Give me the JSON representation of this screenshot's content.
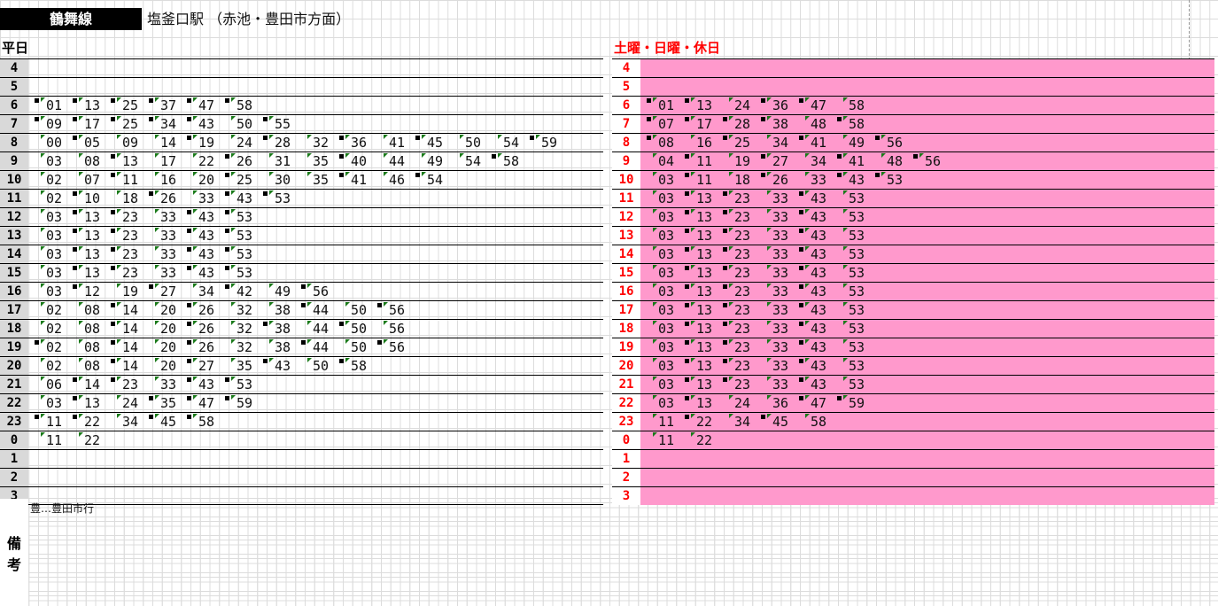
{
  "header": {
    "line_name": "鶴舞線",
    "station": "塩釜口駅 （赤池・豊田市方面）"
  },
  "colors": {
    "weekend_fill": "#ff99cc",
    "weekend_text": "#ff0000",
    "marker": "#1a7a1a"
  },
  "weekday": {
    "title": "平日",
    "rows": [
      {
        "hour": "4",
        "times": []
      },
      {
        "hour": "5",
        "times": []
      },
      {
        "hour": "6",
        "times": [
          [
            "01",
            1
          ],
          [
            "13",
            1
          ],
          [
            "25",
            1
          ],
          [
            "37",
            1
          ],
          [
            "47",
            1
          ],
          [
            "58",
            1
          ]
        ]
      },
      {
        "hour": "7",
        "times": [
          [
            "09",
            1
          ],
          [
            "17",
            1
          ],
          [
            "25",
            1
          ],
          [
            "34",
            1
          ],
          [
            "43",
            1
          ],
          [
            "50",
            0
          ],
          [
            "55",
            1
          ]
        ]
      },
      {
        "hour": "8",
        "times": [
          [
            "00",
            0
          ],
          [
            "05",
            1
          ],
          [
            "09",
            0
          ],
          [
            "14",
            0
          ],
          [
            "19",
            1
          ],
          [
            "24",
            0
          ],
          [
            "28",
            1
          ],
          [
            "32",
            0
          ],
          [
            "36",
            1
          ],
          [
            "41",
            0
          ],
          [
            "45",
            1
          ],
          [
            "50",
            0
          ],
          [
            "54",
            0
          ],
          [
            "59",
            1
          ]
        ]
      },
      {
        "hour": "9",
        "times": [
          [
            "03",
            0
          ],
          [
            "08",
            0
          ],
          [
            "13",
            1
          ],
          [
            "17",
            0
          ],
          [
            "22",
            0
          ],
          [
            "26",
            1
          ],
          [
            "31",
            0
          ],
          [
            "35",
            0
          ],
          [
            "40",
            1
          ],
          [
            "44",
            0
          ],
          [
            "49",
            0
          ],
          [
            "54",
            0
          ],
          [
            "58",
            1
          ]
        ]
      },
      {
        "hour": "10",
        "times": [
          [
            "02",
            0
          ],
          [
            "07",
            0
          ],
          [
            "11",
            1
          ],
          [
            "16",
            0
          ],
          [
            "20",
            0
          ],
          [
            "25",
            1
          ],
          [
            "30",
            0
          ],
          [
            "35",
            0
          ],
          [
            "41",
            1
          ],
          [
            "46",
            0
          ],
          [
            "54",
            1
          ]
        ]
      },
      {
        "hour": "11",
        "times": [
          [
            "02",
            0
          ],
          [
            "10",
            1
          ],
          [
            "18",
            0
          ],
          [
            "26",
            1
          ],
          [
            "33",
            0
          ],
          [
            "43",
            1
          ],
          [
            "53",
            1
          ]
        ]
      },
      {
        "hour": "12",
        "times": [
          [
            "03",
            0
          ],
          [
            "13",
            1
          ],
          [
            "23",
            1
          ],
          [
            "33",
            0
          ],
          [
            "43",
            1
          ],
          [
            "53",
            1
          ]
        ]
      },
      {
        "hour": "13",
        "times": [
          [
            "03",
            0
          ],
          [
            "13",
            1
          ],
          [
            "23",
            1
          ],
          [
            "33",
            0
          ],
          [
            "43",
            1
          ],
          [
            "53",
            1
          ]
        ]
      },
      {
        "hour": "14",
        "times": [
          [
            "03",
            0
          ],
          [
            "13",
            1
          ],
          [
            "23",
            1
          ],
          [
            "33",
            0
          ],
          [
            "43",
            1
          ],
          [
            "53",
            1
          ]
        ]
      },
      {
        "hour": "15",
        "times": [
          [
            "03",
            0
          ],
          [
            "13",
            1
          ],
          [
            "23",
            1
          ],
          [
            "33",
            0
          ],
          [
            "43",
            1
          ],
          [
            "53",
            1
          ]
        ]
      },
      {
        "hour": "16",
        "times": [
          [
            "03",
            0
          ],
          [
            "12",
            1
          ],
          [
            "19",
            0
          ],
          [
            "27",
            1
          ],
          [
            "34",
            0
          ],
          [
            "42",
            1
          ],
          [
            "49",
            0
          ],
          [
            "56",
            1
          ]
        ]
      },
      {
        "hour": "17",
        "times": [
          [
            "02",
            0
          ],
          [
            "08",
            0
          ],
          [
            "14",
            1
          ],
          [
            "20",
            0
          ],
          [
            "26",
            1
          ],
          [
            "32",
            0
          ],
          [
            "38",
            0
          ],
          [
            "44",
            1
          ],
          [
            "50",
            0
          ],
          [
            "56",
            1
          ]
        ]
      },
      {
        "hour": "18",
        "times": [
          [
            "02",
            0
          ],
          [
            "08",
            0
          ],
          [
            "14",
            1
          ],
          [
            "20",
            0
          ],
          [
            "26",
            1
          ],
          [
            "32",
            0
          ],
          [
            "38",
            1
          ],
          [
            "44",
            0
          ],
          [
            "50",
            1
          ],
          [
            "56",
            0
          ]
        ]
      },
      {
        "hour": "19",
        "times": [
          [
            "02",
            1
          ],
          [
            "08",
            0
          ],
          [
            "14",
            1
          ],
          [
            "20",
            0
          ],
          [
            "26",
            1
          ],
          [
            "32",
            0
          ],
          [
            "38",
            0
          ],
          [
            "44",
            1
          ],
          [
            "50",
            0
          ],
          [
            "56",
            1
          ]
        ]
      },
      {
        "hour": "20",
        "times": [
          [
            "02",
            0
          ],
          [
            "08",
            0
          ],
          [
            "14",
            1
          ],
          [
            "20",
            0
          ],
          [
            "27",
            1
          ],
          [
            "35",
            0
          ],
          [
            "43",
            1
          ],
          [
            "50",
            0
          ],
          [
            "58",
            1
          ]
        ]
      },
      {
        "hour": "21",
        "times": [
          [
            "06",
            0
          ],
          [
            "14",
            1
          ],
          [
            "23",
            1
          ],
          [
            "33",
            0
          ],
          [
            "43",
            1
          ],
          [
            "53",
            1
          ]
        ]
      },
      {
        "hour": "22",
        "times": [
          [
            "03",
            0
          ],
          [
            "13",
            1
          ],
          [
            "24",
            0
          ],
          [
            "35",
            1
          ],
          [
            "47",
            1
          ],
          [
            "59",
            1
          ]
        ]
      },
      {
        "hour": "23",
        "times": [
          [
            "11",
            1
          ],
          [
            "22",
            1
          ],
          [
            "34",
            0
          ],
          [
            "45",
            1
          ],
          [
            "58",
            1
          ]
        ]
      },
      {
        "hour": "0",
        "times": [
          [
            "11",
            0
          ],
          [
            "22",
            0
          ]
        ]
      },
      {
        "hour": "1",
        "times": []
      },
      {
        "hour": "2",
        "times": []
      },
      {
        "hour": "3",
        "times": []
      }
    ]
  },
  "weekend": {
    "title": "土曜・日曜・休日",
    "rows": [
      {
        "hour": "4",
        "times": []
      },
      {
        "hour": "5",
        "times": []
      },
      {
        "hour": "6",
        "times": [
          [
            "01",
            1
          ],
          [
            "13",
            1
          ],
          [
            "24",
            0
          ],
          [
            "36",
            1
          ],
          [
            "47",
            1
          ],
          [
            "58",
            0
          ]
        ]
      },
      {
        "hour": "7",
        "times": [
          [
            "07",
            1
          ],
          [
            "17",
            1
          ],
          [
            "28",
            1
          ],
          [
            "38",
            1
          ],
          [
            "48",
            0
          ],
          [
            "58",
            1
          ]
        ]
      },
      {
        "hour": "8",
        "times": [
          [
            "08",
            1
          ],
          [
            "16",
            0
          ],
          [
            "25",
            1
          ],
          [
            "34",
            0
          ],
          [
            "41",
            1
          ],
          [
            "49",
            0
          ],
          [
            "56",
            1
          ]
        ]
      },
      {
        "hour": "9",
        "times": [
          [
            "04",
            0
          ],
          [
            "11",
            1
          ],
          [
            "19",
            0
          ],
          [
            "27",
            1
          ],
          [
            "34",
            0
          ],
          [
            "41",
            1
          ],
          [
            "48",
            0
          ],
          [
            "56",
            1
          ]
        ]
      },
      {
        "hour": "10",
        "times": [
          [
            "03",
            0
          ],
          [
            "11",
            1
          ],
          [
            "18",
            0
          ],
          [
            "26",
            1
          ],
          [
            "33",
            0
          ],
          [
            "43",
            1
          ],
          [
            "53",
            1
          ]
        ]
      },
      {
        "hour": "11",
        "times": [
          [
            "03",
            0
          ],
          [
            "13",
            1
          ],
          [
            "23",
            1
          ],
          [
            "33",
            0
          ],
          [
            "43",
            1
          ],
          [
            "53",
            0
          ]
        ]
      },
      {
        "hour": "12",
        "times": [
          [
            "03",
            0
          ],
          [
            "13",
            1
          ],
          [
            "23",
            1
          ],
          [
            "33",
            0
          ],
          [
            "43",
            1
          ],
          [
            "53",
            0
          ]
        ]
      },
      {
        "hour": "13",
        "times": [
          [
            "03",
            0
          ],
          [
            "13",
            1
          ],
          [
            "23",
            1
          ],
          [
            "33",
            0
          ],
          [
            "43",
            1
          ],
          [
            "53",
            0
          ]
        ]
      },
      {
        "hour": "14",
        "times": [
          [
            "03",
            0
          ],
          [
            "13",
            1
          ],
          [
            "23",
            1
          ],
          [
            "33",
            0
          ],
          [
            "43",
            1
          ],
          [
            "53",
            0
          ]
        ]
      },
      {
        "hour": "15",
        "times": [
          [
            "03",
            0
          ],
          [
            "13",
            1
          ],
          [
            "23",
            1
          ],
          [
            "33",
            0
          ],
          [
            "43",
            1
          ],
          [
            "53",
            0
          ]
        ]
      },
      {
        "hour": "16",
        "times": [
          [
            "03",
            0
          ],
          [
            "13",
            1
          ],
          [
            "23",
            1
          ],
          [
            "33",
            0
          ],
          [
            "43",
            1
          ],
          [
            "53",
            0
          ]
        ]
      },
      {
        "hour": "17",
        "times": [
          [
            "03",
            0
          ],
          [
            "13",
            1
          ],
          [
            "23",
            1
          ],
          [
            "33",
            0
          ],
          [
            "43",
            1
          ],
          [
            "53",
            0
          ]
        ]
      },
      {
        "hour": "18",
        "times": [
          [
            "03",
            0
          ],
          [
            "13",
            1
          ],
          [
            "23",
            1
          ],
          [
            "33",
            0
          ],
          [
            "43",
            1
          ],
          [
            "53",
            0
          ]
        ]
      },
      {
        "hour": "19",
        "times": [
          [
            "03",
            0
          ],
          [
            "13",
            1
          ],
          [
            "23",
            1
          ],
          [
            "33",
            0
          ],
          [
            "43",
            1
          ],
          [
            "53",
            0
          ]
        ]
      },
      {
        "hour": "20",
        "times": [
          [
            "03",
            0
          ],
          [
            "13",
            1
          ],
          [
            "23",
            1
          ],
          [
            "33",
            0
          ],
          [
            "43",
            1
          ],
          [
            "53",
            0
          ]
        ]
      },
      {
        "hour": "21",
        "times": [
          [
            "03",
            0
          ],
          [
            "13",
            1
          ],
          [
            "23",
            1
          ],
          [
            "33",
            0
          ],
          [
            "43",
            1
          ],
          [
            "53",
            0
          ]
        ]
      },
      {
        "hour": "22",
        "times": [
          [
            "03",
            0
          ],
          [
            "13",
            1
          ],
          [
            "24",
            0
          ],
          [
            "36",
            0
          ],
          [
            "47",
            1
          ],
          [
            "59",
            1
          ]
        ]
      },
      {
        "hour": "23",
        "times": [
          [
            "11",
            0
          ],
          [
            "22",
            1
          ],
          [
            "34",
            0
          ],
          [
            "45",
            1
          ],
          [
            "58",
            0
          ]
        ]
      },
      {
        "hour": "0",
        "times": [
          [
            "11",
            0
          ],
          [
            "22",
            0
          ]
        ]
      },
      {
        "hour": "1",
        "times": []
      },
      {
        "hour": "2",
        "times": []
      },
      {
        "hour": "3",
        "times": []
      }
    ]
  },
  "notes": {
    "label_1": "備",
    "label_2": "考",
    "text": "豊…豊田市行"
  }
}
